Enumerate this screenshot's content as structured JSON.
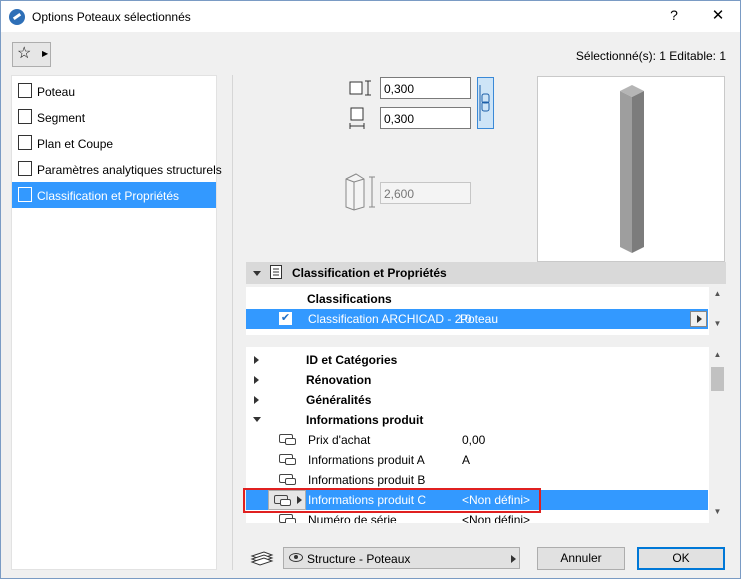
{
  "window": {
    "title": "Options Poteaux sélectionnés",
    "help_label": "?",
    "close_label": "✕"
  },
  "toolbar": {
    "favorites_icon": "star-icon",
    "selection_info": "Sélectionné(s): 1 Editable: 1"
  },
  "sidebar": {
    "items": [
      {
        "label": "Poteau",
        "icon": "column-icon"
      },
      {
        "label": "Segment",
        "icon": "segment-icon"
      },
      {
        "label": "Plan et Coupe",
        "icon": "floor-plan-icon"
      },
      {
        "label": "Paramètres analytiques structurels",
        "icon": "structural-analysis-icon"
      },
      {
        "label": "Classification et Propriétés",
        "icon": "classification-icon"
      }
    ]
  },
  "geometry_fields": {
    "width": "0,300",
    "depth": "0,300",
    "height": "2,600"
  },
  "panel": {
    "title": "Classification et Propriétés"
  },
  "classifications": {
    "header": "Classifications",
    "row_system": "Classification ARCHICAD - 2.0",
    "row_value": "Poteau"
  },
  "properties": {
    "groups": [
      {
        "label": "ID et Catégories"
      },
      {
        "label": "Rénovation"
      },
      {
        "label": "Généralités"
      },
      {
        "label": "Informations produit"
      }
    ],
    "rows": [
      {
        "name": "Prix d'achat",
        "value": "0,00"
      },
      {
        "name": "Informations produit A",
        "value": "A"
      },
      {
        "name": "Informations produit B",
        "value": ""
      },
      {
        "name": "Informations produit C",
        "value": "<Non défini>"
      },
      {
        "name": "Numéro de série",
        "value": "<Non défini>"
      }
    ]
  },
  "footer": {
    "layer": "Structure - Poteaux",
    "cancel_label": "Annuler",
    "ok_label": "OK"
  },
  "colors": {
    "selection": "#3399ff",
    "highlight_box": "#e02020"
  }
}
